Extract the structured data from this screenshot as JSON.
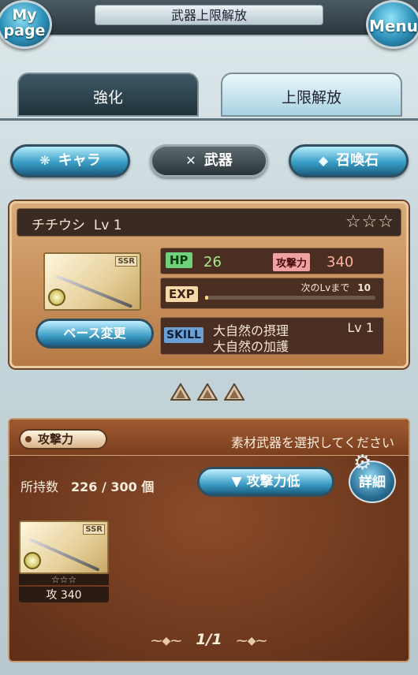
{
  "header": {
    "title": "武器上限解放",
    "mypage_line1": "My",
    "mypage_line2": "page",
    "menu": "Menu"
  },
  "tabs": [
    {
      "label": "強化",
      "active": false
    },
    {
      "label": "上限解放",
      "active": true
    }
  ],
  "categories": [
    {
      "label": "キャラ",
      "icon": "chara-icon"
    },
    {
      "label": "武器",
      "icon": "swords-icon",
      "active": true
    },
    {
      "label": "召喚石",
      "icon": "crystal-icon"
    }
  ],
  "base": {
    "name": "チチウシ",
    "level": "Lv 1",
    "stars": "☆☆☆",
    "rarity": "SSR",
    "hp_label": "HP",
    "hp": "26",
    "atk_label": "攻撃力",
    "atk": "340",
    "exp_label": "EXP",
    "next_label": "次のLvまで",
    "next_value": "10",
    "exp_progress": 0.0,
    "skill_label": "SKILL",
    "skill_1": "大自然の摂理",
    "skill_2": "大自然の加護",
    "skill_level": "Lv 1",
    "base_change": "ベース変更"
  },
  "materials": {
    "sort_key": "攻撃力",
    "instruction": "素材武器を選択してください",
    "owned_label": "所持数",
    "owned": "226 / 300 個",
    "sort_button": "▼ 攻撃力低",
    "detail_button": "詳細",
    "items": [
      {
        "rarity": "SSR",
        "stars": "☆☆☆",
        "atk": "攻 340"
      }
    ],
    "pagination": "1/1"
  },
  "colors": {
    "accent": "#3c9dc5",
    "panel": "#b77a45",
    "section": "#6b3519"
  }
}
